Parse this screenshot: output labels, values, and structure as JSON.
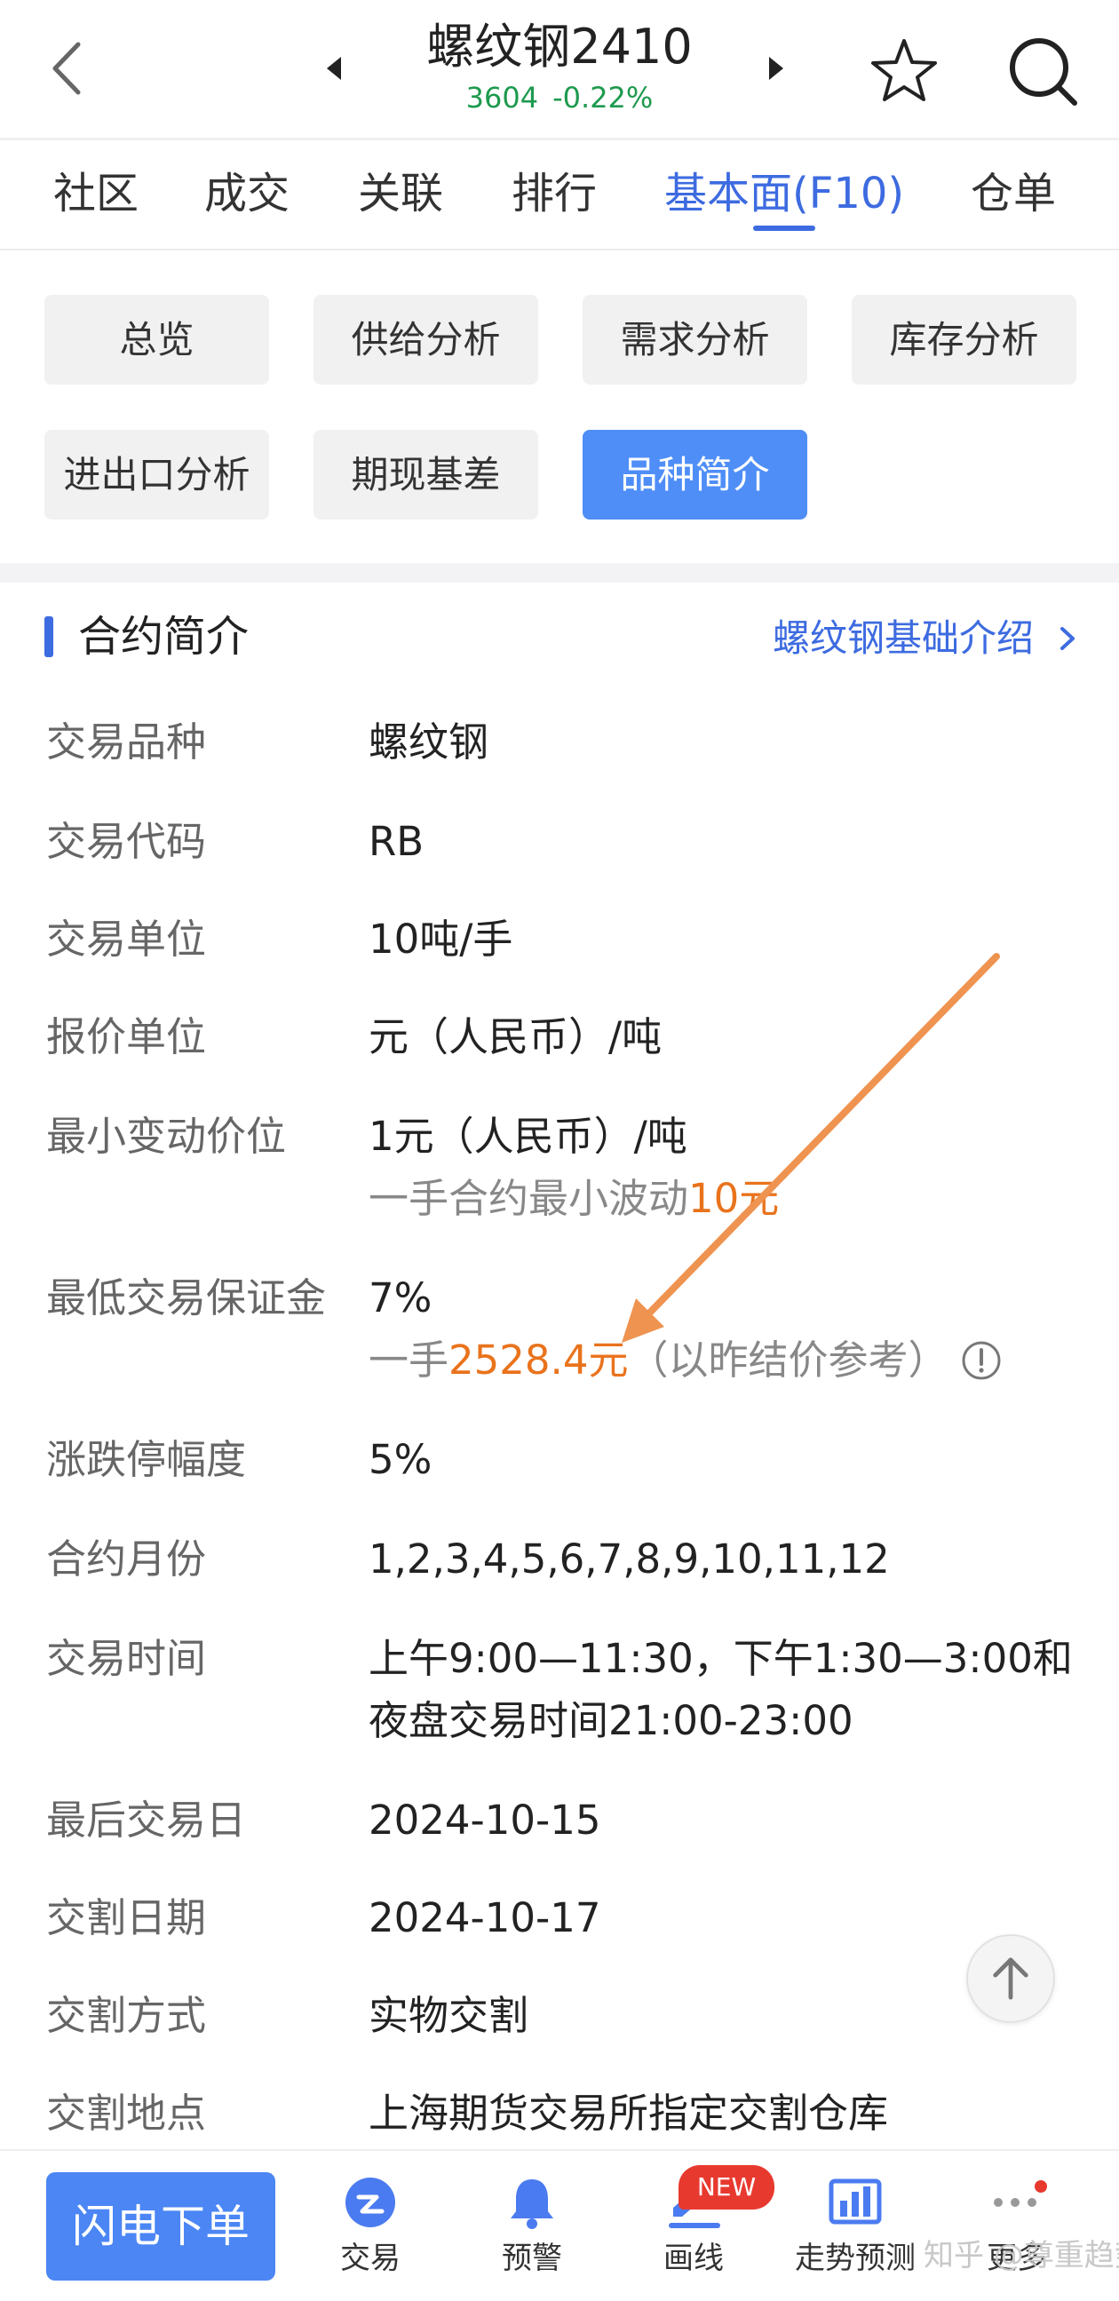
{
  "header": {
    "title": "螺纹钢2410",
    "price": "3604",
    "change": "-0.22%"
  },
  "tabs": [
    {
      "label": "社区"
    },
    {
      "label": "成交"
    },
    {
      "label": "关联"
    },
    {
      "label": "排行"
    },
    {
      "label": "基本面(F10)",
      "active": true
    },
    {
      "label": "仓单"
    }
  ],
  "subtabs": [
    {
      "label": "总览"
    },
    {
      "label": "供给分析"
    },
    {
      "label": "需求分析"
    },
    {
      "label": "库存分析"
    },
    {
      "label": "进出口分析"
    },
    {
      "label": "期现基差"
    },
    {
      "label": "品种简介",
      "active": true
    }
  ],
  "section": {
    "title": "合约简介",
    "link": "螺纹钢基础介绍"
  },
  "rows": [
    {
      "label": "交易品种",
      "value": "螺纹钢"
    },
    {
      "label": "交易代码",
      "value": "RB"
    },
    {
      "label": "交易单位",
      "value": "10吨/手"
    },
    {
      "label": "报价单位",
      "value": "元（人民币）/吨"
    },
    {
      "label": "最小变动价位",
      "value": "1元（人民币）/吨",
      "sub_prefix": "一手合约最小波动",
      "sub_highlight": "10元"
    },
    {
      "label": "最低交易保证金",
      "value": "7%",
      "sub_prefix": "一手",
      "sub_highlight": "2528.4元",
      "sub_suffix": "（以昨结价参考）"
    },
    {
      "label": "涨跌停幅度",
      "value": "5%"
    },
    {
      "label": "合约月份",
      "value": "1,2,3,4,5,6,7,8,9,10,11,12"
    },
    {
      "label": "交易时间",
      "value": "上午9:00—11:30，下午1:30—3:00和",
      "value2": "夜盘交易时间21:00-23:00"
    },
    {
      "label": "最后交易日",
      "value": "2024-10-15"
    },
    {
      "label": "交割日期",
      "value": "2024-10-17"
    },
    {
      "label": "交割方式",
      "value": "实物交割"
    },
    {
      "label": "交割地点",
      "value": "上海期货交易所指定交割仓库"
    }
  ],
  "bottom": {
    "flash": "闪电下单",
    "nav": [
      {
        "label": "交易",
        "icon": "trade-icon"
      },
      {
        "label": "预警",
        "icon": "bell-icon"
      },
      {
        "label": "画线",
        "icon": "draw-line-icon",
        "badge": "NEW"
      },
      {
        "label": "走势预测",
        "icon": "trend-chart-icon"
      },
      {
        "label": "更多",
        "icon": "more-dots-icon"
      }
    ],
    "watermark": "知乎 @尊重趋势"
  },
  "colors": {
    "accent": "#3d6be0",
    "chip_active": "#4f8ef7",
    "highlight": "#e9731c",
    "up_down": "#1e9a4e",
    "badge": "#e8392f"
  }
}
